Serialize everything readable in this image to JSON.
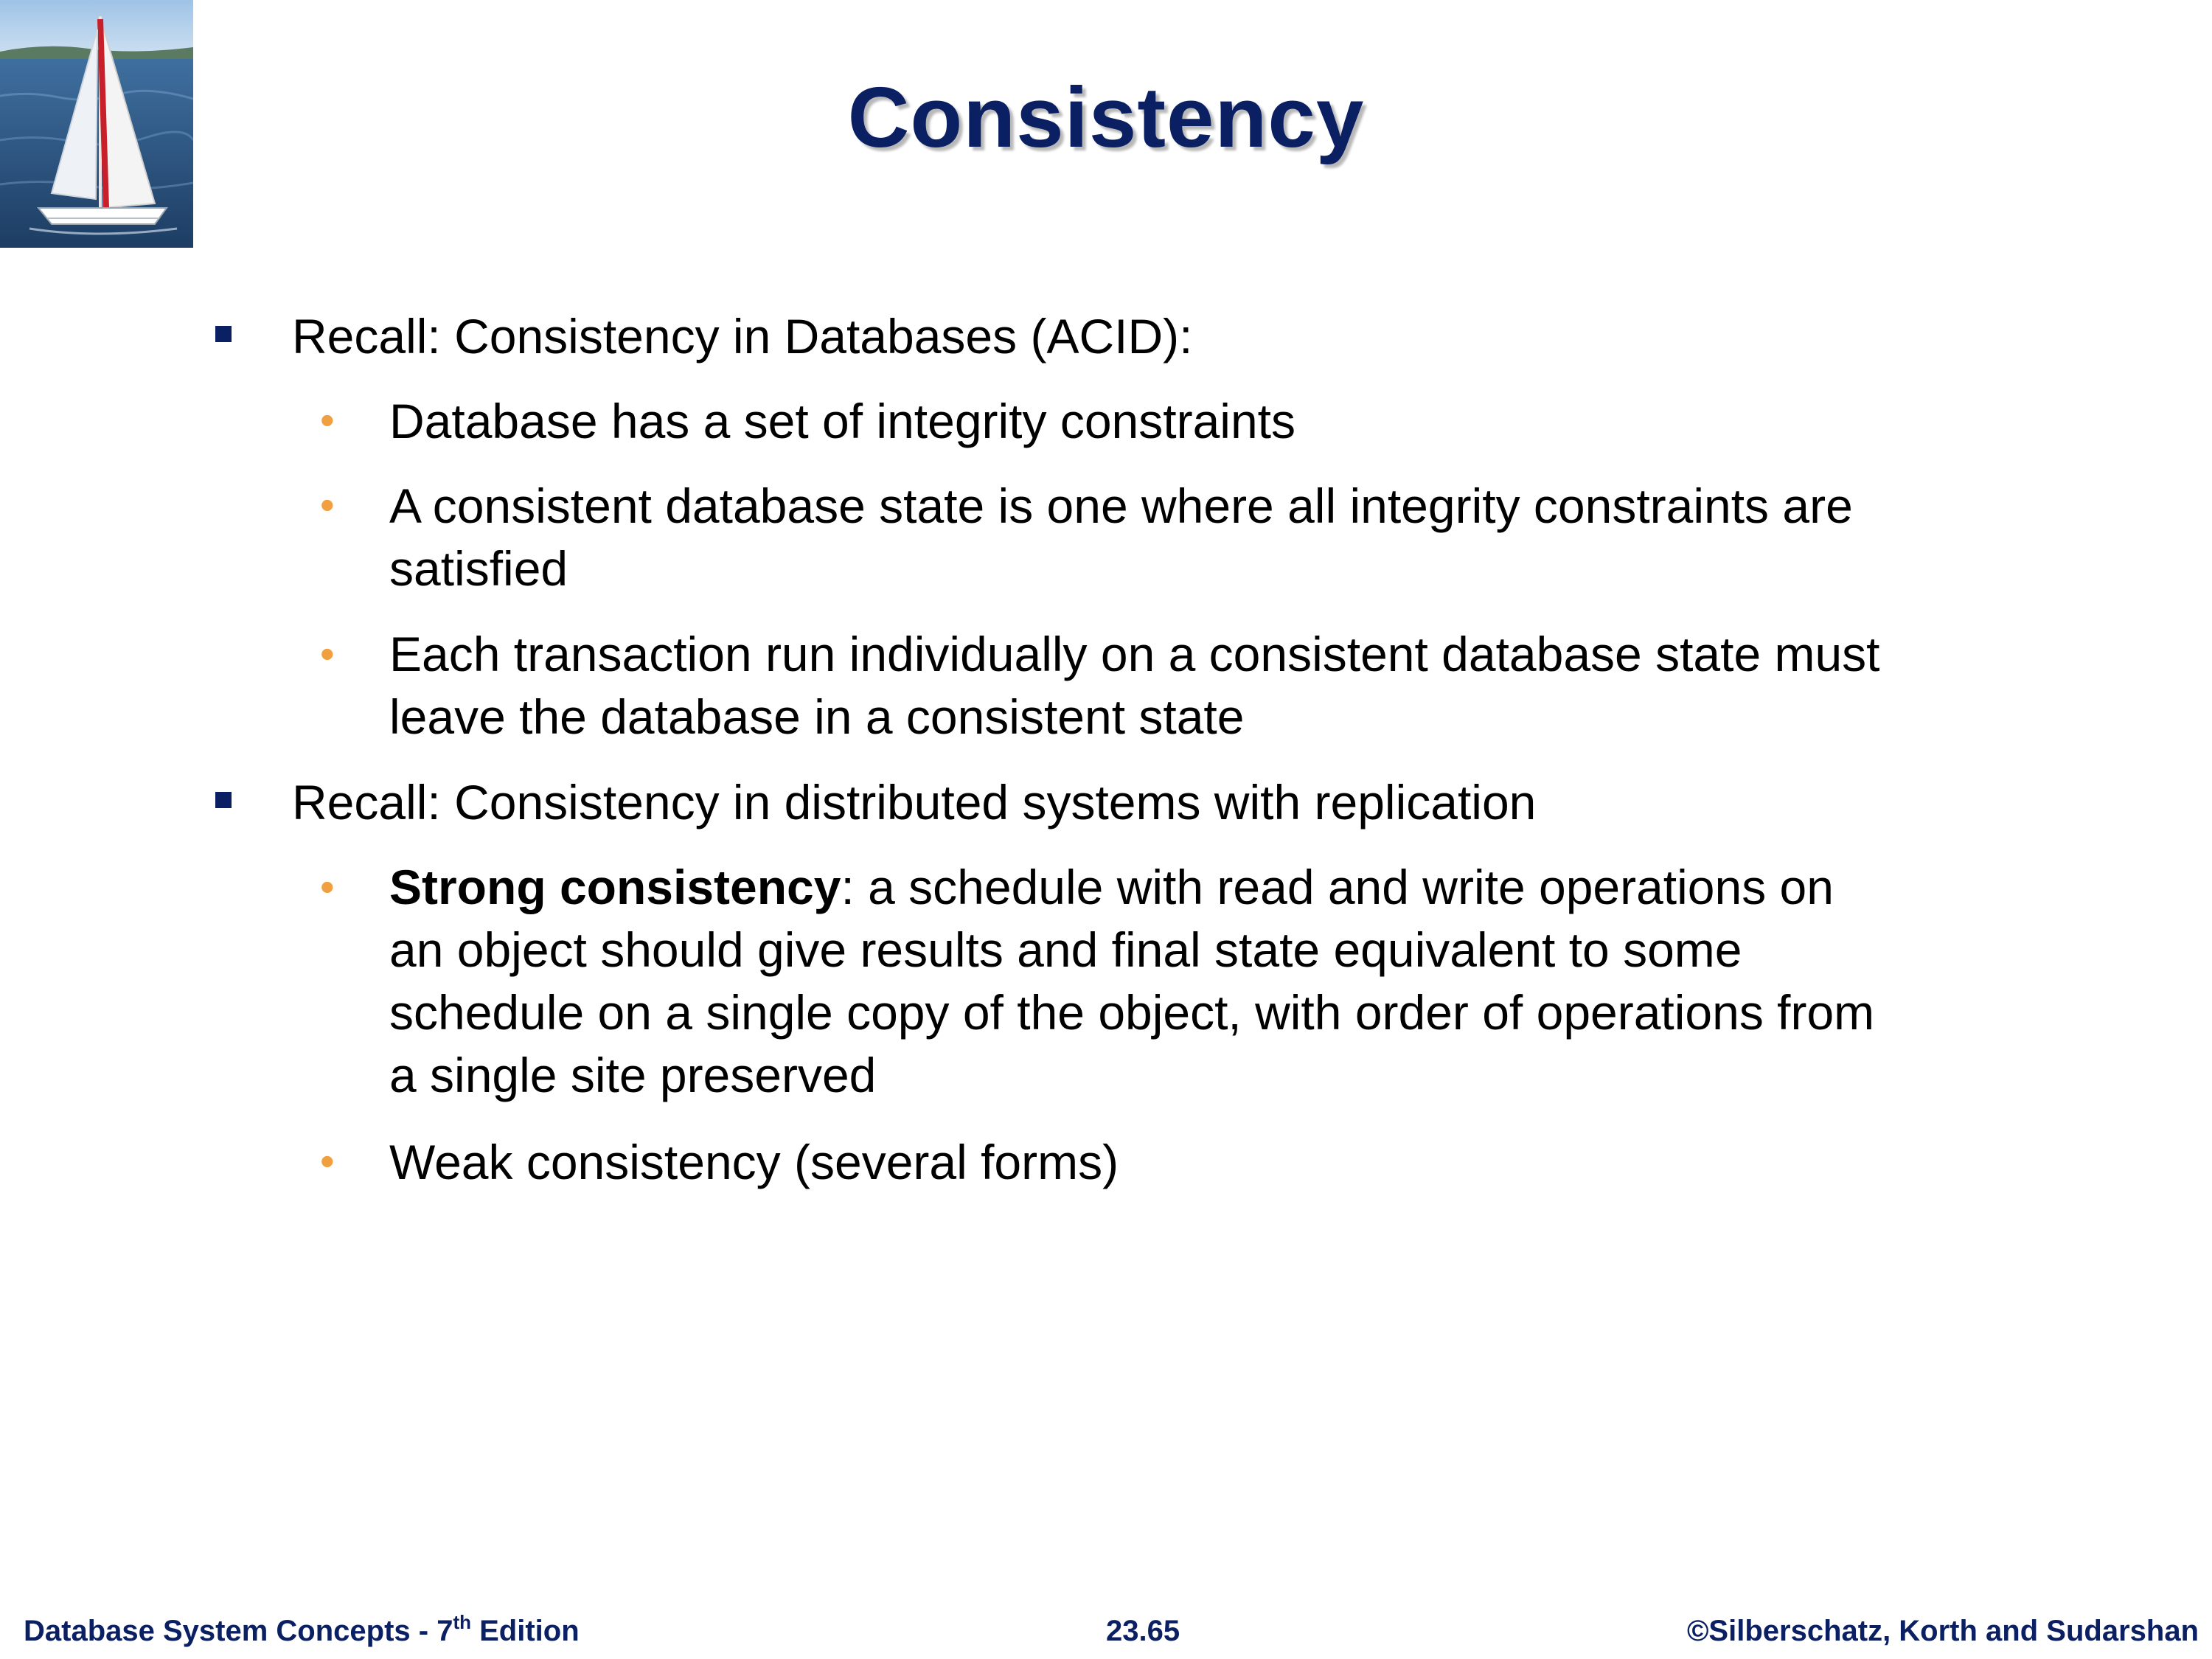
{
  "slide": {
    "title": "Consistency"
  },
  "bullets": {
    "b1": "Recall:  Consistency in Databases (ACID):",
    "b1_1": "Database has a set of integrity constraints",
    "b1_2_line1": "A consistent database state is one where all integrity constraints are",
    "b1_2_line2": "satisfied",
    "b1_3_line1": "Each transaction run individually on a consistent database state must",
    "b1_3_line2": "leave the database in a consistent state",
    "b2": "Recall:  Consistency in distributed systems with replication",
    "b2_1_bold": "Strong consistency",
    "b2_1_line1_rest": ": a schedule with read and write operations on",
    "b2_1_line2": "an object should give results and final state equivalent to some",
    "b2_1_line3": "schedule on a single copy of the object, with order of operations from",
    "b2_1_line4": "a single site preserved",
    "b2_2": "Weak consistency (several forms)"
  },
  "footer": {
    "left_main": "Database System Concepts - 7",
    "left_sup": "th",
    "left_tail": " Edition",
    "center": "23.65",
    "right": "©Silberschatz, Korth and Sudarshan"
  },
  "colors": {
    "title": "#0b1f63",
    "square_bullet": "#0b1f63",
    "round_bullet": "#f0a040",
    "footer": "#0b1f63"
  },
  "icons": {
    "logo": "sailboat-logo-image",
    "level1_marker": "square-bullet-icon",
    "level2_marker": "round-bullet-icon"
  }
}
